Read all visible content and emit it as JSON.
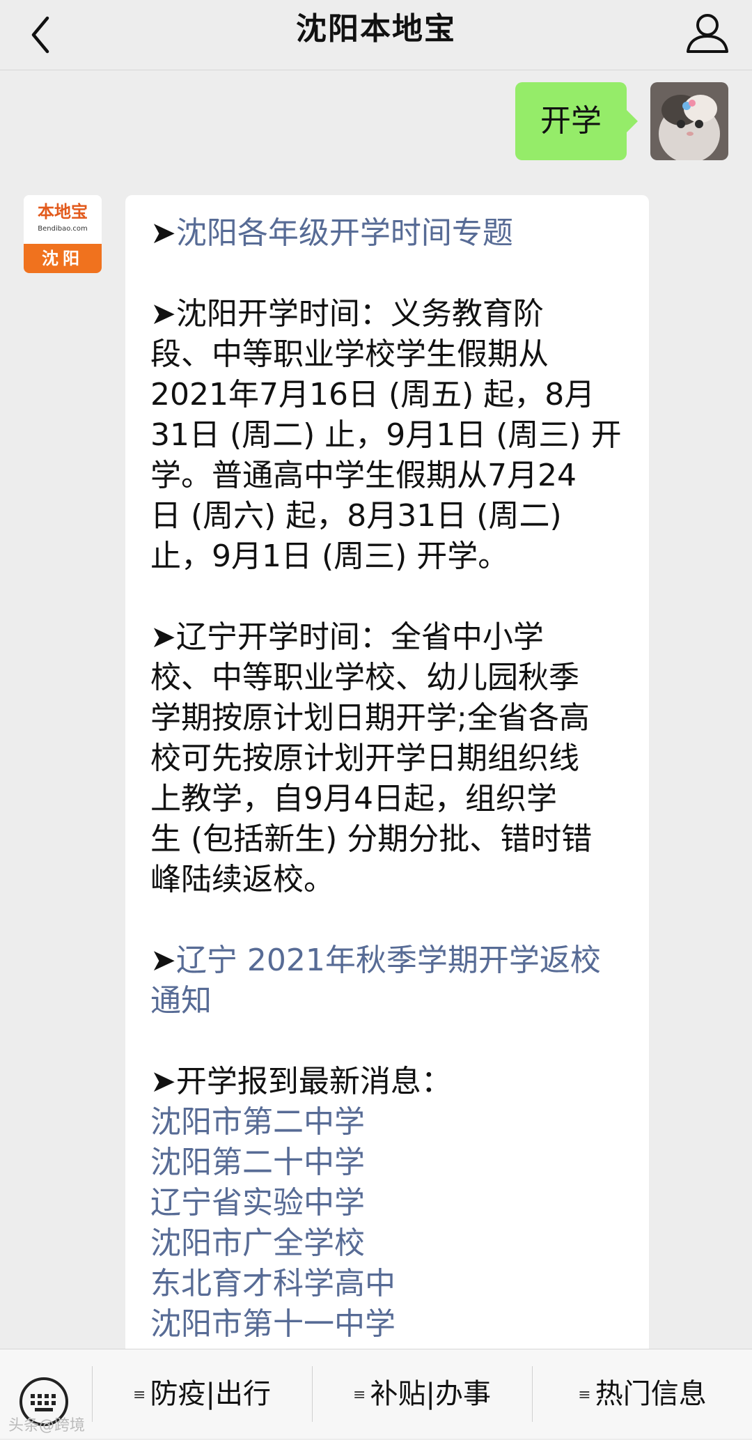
{
  "header": {
    "title": "沈阳本地宝",
    "back_icon": "chevron-left-icon",
    "profile_icon": "person-icon"
  },
  "user_message": {
    "text": "开学",
    "bubble_color": "#95ec69"
  },
  "bot_avatar": {
    "logo_main": "本地宝",
    "logo_sub": "Bendibao.com",
    "city": "沈阳"
  },
  "bot_message": {
    "marker": "➤",
    "link_color": "#576b95",
    "topic_link": "沈阳各年级开学时间专题",
    "shenyang": {
      "label": "沈阳开学时间：",
      "lines": [
        "义务教育阶",
        "段、中等职业学校学生假期从",
        "2021年7月16日 (周五) 起，8月",
        "31日 (周二) 止，9月1日 (周三) 开",
        "学。普通高中学生假期从7月24",
        "日 (周六) 起，8月31日 (周二)",
        "止，9月1日 (周三) 开学。"
      ]
    },
    "liaoning": {
      "label": "辽宁开学时间：",
      "lines": [
        "全省中小学",
        "校、中等职业学校、幼儿园秋季",
        "学期按原计划日期开学;全省各高",
        "校可先按原计划开学日期组织线",
        "上教学，自9月4日起，组织学",
        "生 (包括新生) 分期分批、错时错",
        "峰陆续返校。"
      ]
    },
    "notice_link": {
      "line1": "辽宁 2021年秋季学期开学返校",
      "line2": "通知"
    },
    "news": {
      "label": "开学报到最新消息：",
      "links": [
        "沈阳市第二中学",
        "沈阳第二十中学",
        "辽宁省实验中学",
        "沈阳市广全学校",
        "东北育才科学高中",
        "沈阳市第十一中学"
      ]
    }
  },
  "bottom_menu": {
    "keyboard_icon": "keyboard-icon",
    "items": [
      {
        "label": "防疫|出行"
      },
      {
        "label": "补贴|办事"
      },
      {
        "label": "热门信息"
      }
    ]
  },
  "watermark": "头条@跨境"
}
